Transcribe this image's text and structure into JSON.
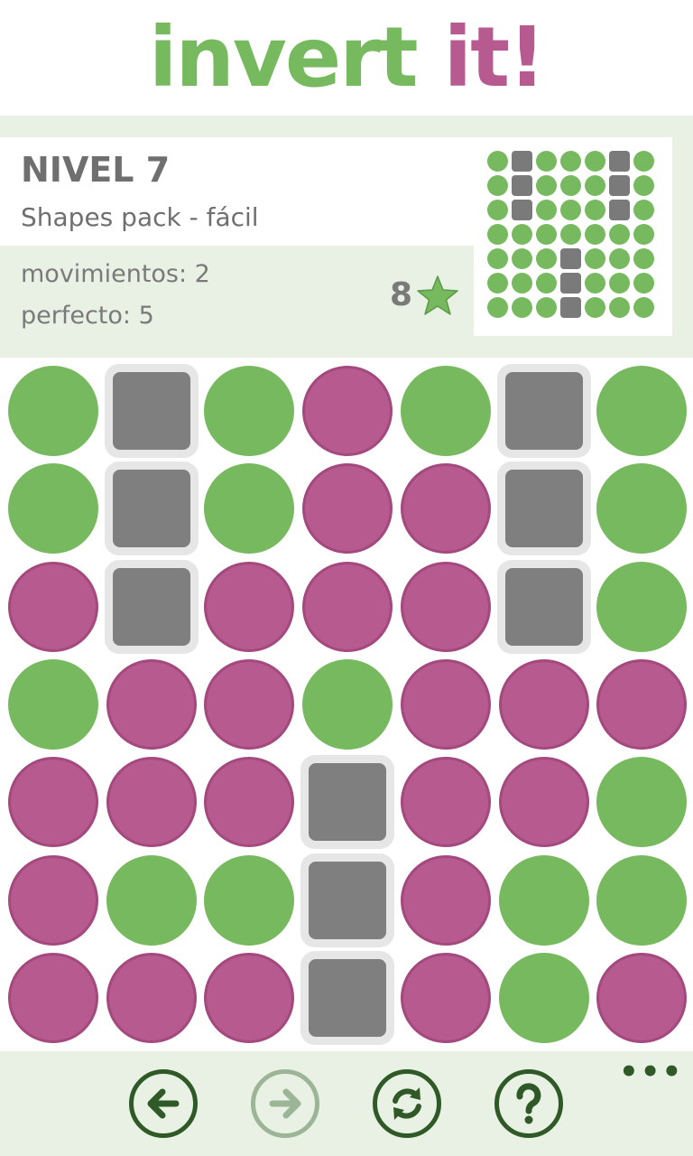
{
  "app": {
    "title_part1": "invert",
    "title_part2": "it!"
  },
  "level": {
    "title": "NIVEL 7",
    "pack": "Shapes pack - fácil",
    "moves_text": "movimientos: 2",
    "perfect_text": "perfecto: 5",
    "stars": "8"
  },
  "colors": {
    "green": "#76b95e",
    "pink": "#b65a8f",
    "block": "#7f7f7f",
    "panel": "#e8f1e4",
    "button": "#2f5a28"
  },
  "preview_grid": [
    [
      "g",
      "b",
      "g",
      "g",
      "g",
      "b",
      "g"
    ],
    [
      "g",
      "b",
      "g",
      "g",
      "g",
      "b",
      "g"
    ],
    [
      "g",
      "b",
      "g",
      "g",
      "g",
      "b",
      "g"
    ],
    [
      "g",
      "g",
      "g",
      "g",
      "g",
      "g",
      "g"
    ],
    [
      "g",
      "g",
      "g",
      "b",
      "g",
      "g",
      "g"
    ],
    [
      "g",
      "g",
      "g",
      "b",
      "g",
      "g",
      "g"
    ],
    [
      "g",
      "g",
      "g",
      "b",
      "g",
      "g",
      "g"
    ]
  ],
  "board": [
    [
      "g",
      "b",
      "g",
      "p",
      "g",
      "b",
      "g"
    ],
    [
      "g",
      "b",
      "g",
      "p",
      "p",
      "b",
      "g"
    ],
    [
      "p",
      "b",
      "p",
      "p",
      "p",
      "b",
      "g"
    ],
    [
      "g",
      "p",
      "p",
      "g",
      "p",
      "p",
      "p"
    ],
    [
      "p",
      "p",
      "p",
      "b",
      "p",
      "p",
      "g"
    ],
    [
      "p",
      "g",
      "g",
      "b",
      "p",
      "g",
      "g"
    ],
    [
      "p",
      "p",
      "p",
      "b",
      "p",
      "g",
      "p"
    ]
  ],
  "appbar": {
    "buttons": [
      {
        "name": "back-button",
        "icon": "arrow-left-icon",
        "enabled": true
      },
      {
        "name": "forward-button",
        "icon": "arrow-right-icon",
        "enabled": false
      },
      {
        "name": "restart-button",
        "icon": "refresh-icon",
        "enabled": true
      },
      {
        "name": "help-button",
        "icon": "question-icon",
        "enabled": true
      }
    ],
    "more": "•••"
  }
}
